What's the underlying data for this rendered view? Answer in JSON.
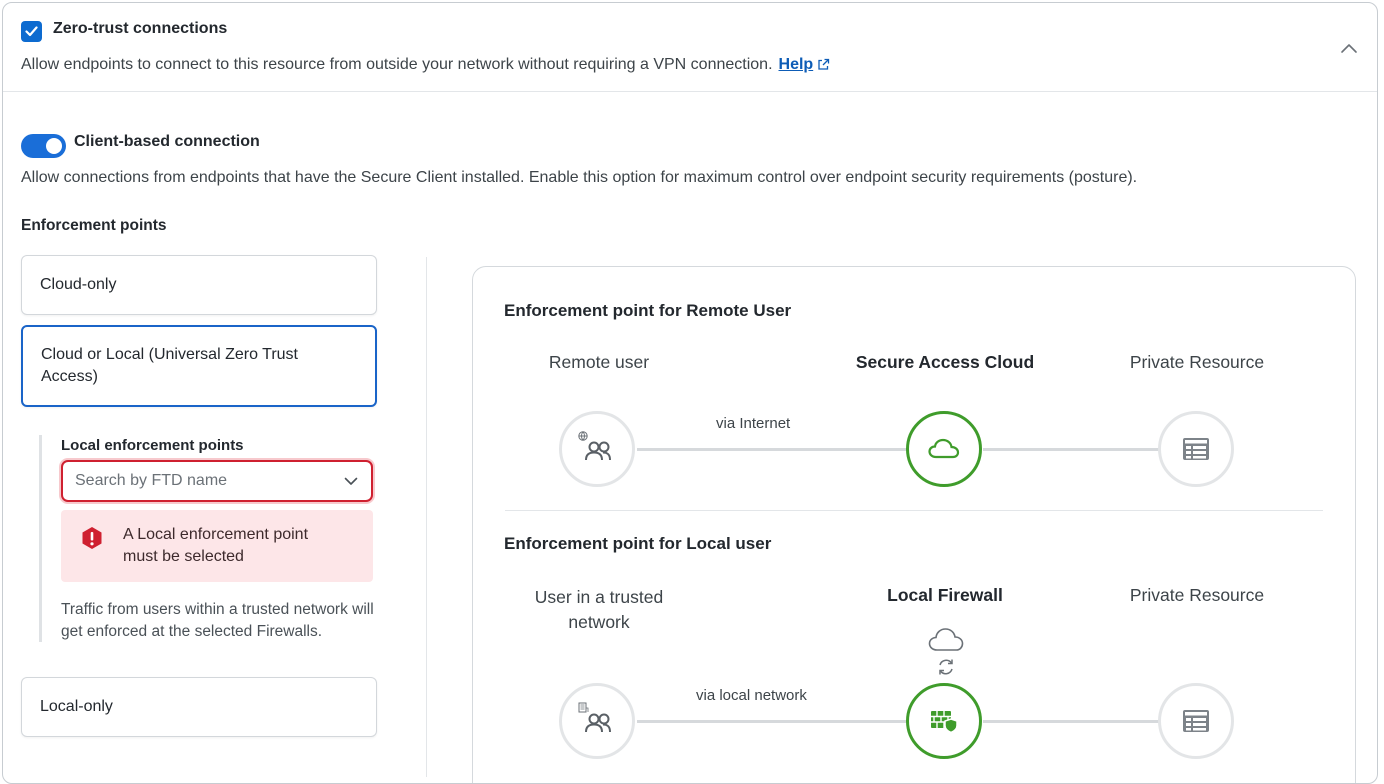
{
  "zero_trust": {
    "title": "Zero-trust connections",
    "description": "Allow endpoints to connect to this resource from outside your network without requiring a VPN connection.",
    "help_label": "Help",
    "checked": true
  },
  "client_based": {
    "title": "Client-based connection",
    "description": "Allow connections from endpoints that have the Secure Client installed. Enable this option for maximum control over endpoint security requirements (posture).",
    "enabled": true
  },
  "enforcement": {
    "title": "Enforcement points",
    "options": [
      {
        "label": "Cloud-only",
        "selected": false
      },
      {
        "label": "Cloud or Local (Universal Zero Trust Access)",
        "selected": true
      },
      {
        "label": "Local-only",
        "selected": false
      }
    ],
    "local": {
      "title": "Local enforcement points",
      "search_placeholder": "Search by FTD name",
      "error": "A Local enforcement point must be selected",
      "note": "Traffic from users within a trusted network will get enforced at the selected Firewalls."
    }
  },
  "diagram": {
    "remote": {
      "title": "Enforcement point for Remote User",
      "labels": [
        "Remote user",
        "Secure Access Cloud",
        "Private Resource"
      ],
      "via": "via Internet",
      "icons": [
        "remote-users-icon",
        "cloud-icon",
        "server-icon"
      ]
    },
    "local": {
      "title": "Enforcement point for Local user",
      "labels": [
        "User in a trusted network",
        "Local Firewall",
        "Private Resource"
      ],
      "via": "via local network",
      "icons": [
        "local-users-icon",
        "firewall-icon",
        "server-icon"
      ]
    }
  },
  "colors": {
    "accent": "#0d6bd0",
    "error": "#cf2030",
    "error_bg": "#fde6e8",
    "success": "#3f9c2b"
  }
}
